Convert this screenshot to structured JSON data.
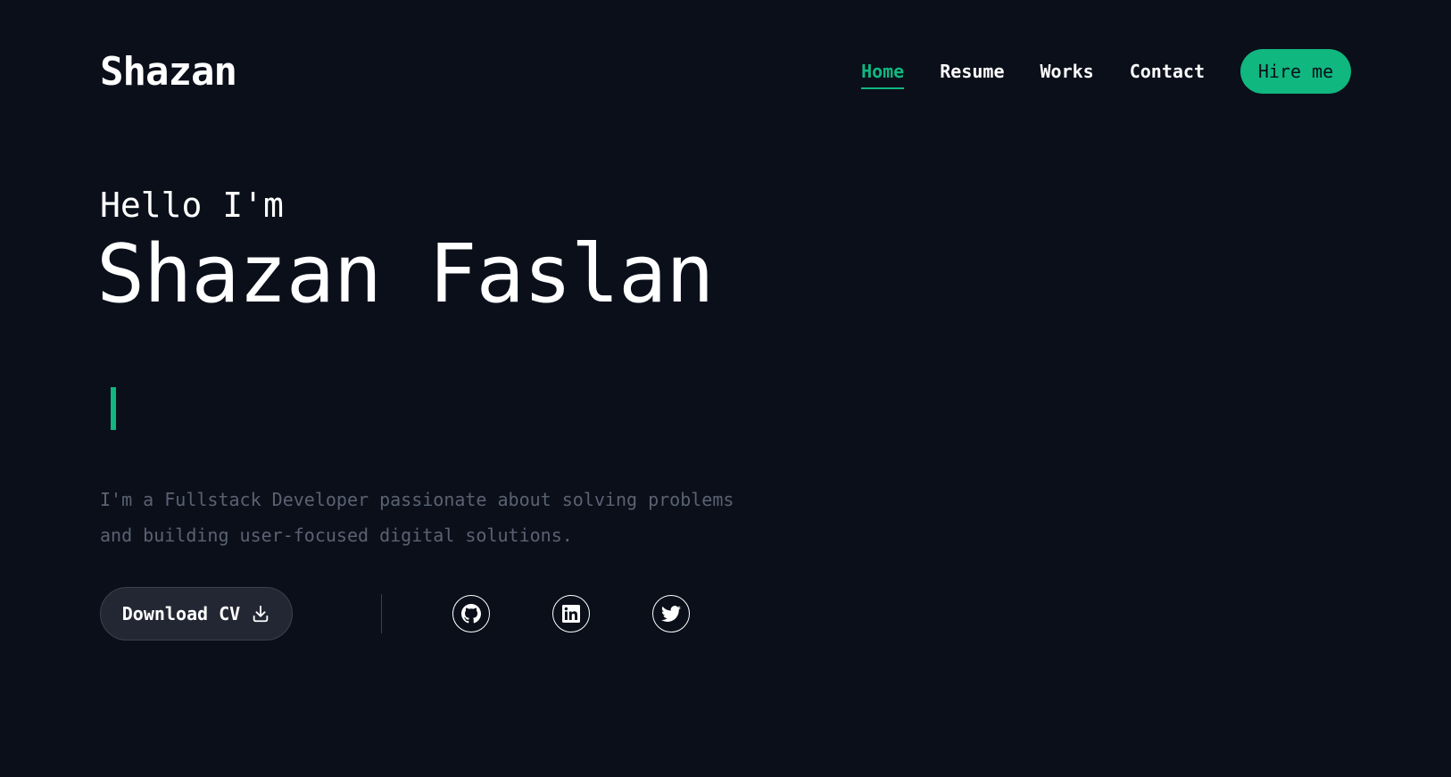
{
  "header": {
    "logo": "Shazan",
    "nav": [
      {
        "label": "Home",
        "active": true
      },
      {
        "label": "Resume",
        "active": false
      },
      {
        "label": "Works",
        "active": false
      },
      {
        "label": "Contact",
        "active": false
      }
    ],
    "hire_label": "Hire me"
  },
  "hero": {
    "greeting": "Hello I'm",
    "name": "Shazan Faslan",
    "description": "I'm a Fullstack Developer passionate about solving problems and building user-focused digital solutions.",
    "download_label": "Download CV"
  },
  "social": [
    {
      "icon": "github-icon"
    },
    {
      "icon": "linkedin-icon"
    },
    {
      "icon": "twitter-icon"
    }
  ],
  "colors": {
    "background": "#0a0f1a",
    "accent": "#10b77f",
    "muted_text": "#5a6272",
    "button_bg": "#232733"
  }
}
